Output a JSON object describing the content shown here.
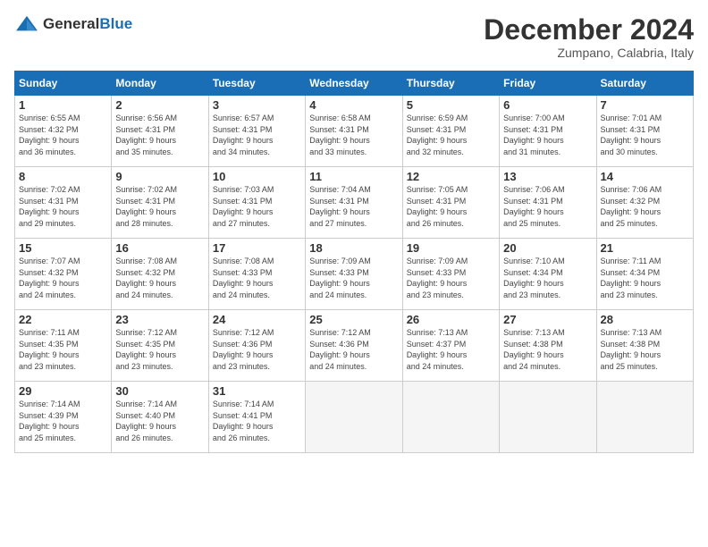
{
  "header": {
    "logo_general": "General",
    "logo_blue": "Blue",
    "month": "December 2024",
    "location": "Zumpano, Calabria, Italy"
  },
  "weekdays": [
    "Sunday",
    "Monday",
    "Tuesday",
    "Wednesday",
    "Thursday",
    "Friday",
    "Saturday"
  ],
  "weeks": [
    [
      {
        "day": "1",
        "info": "Sunrise: 6:55 AM\nSunset: 4:32 PM\nDaylight: 9 hours\nand 36 minutes."
      },
      {
        "day": "2",
        "info": "Sunrise: 6:56 AM\nSunset: 4:31 PM\nDaylight: 9 hours\nand 35 minutes."
      },
      {
        "day": "3",
        "info": "Sunrise: 6:57 AM\nSunset: 4:31 PM\nDaylight: 9 hours\nand 34 minutes."
      },
      {
        "day": "4",
        "info": "Sunrise: 6:58 AM\nSunset: 4:31 PM\nDaylight: 9 hours\nand 33 minutes."
      },
      {
        "day": "5",
        "info": "Sunrise: 6:59 AM\nSunset: 4:31 PM\nDaylight: 9 hours\nand 32 minutes."
      },
      {
        "day": "6",
        "info": "Sunrise: 7:00 AM\nSunset: 4:31 PM\nDaylight: 9 hours\nand 31 minutes."
      },
      {
        "day": "7",
        "info": "Sunrise: 7:01 AM\nSunset: 4:31 PM\nDaylight: 9 hours\nand 30 minutes."
      }
    ],
    [
      {
        "day": "8",
        "info": "Sunrise: 7:02 AM\nSunset: 4:31 PM\nDaylight: 9 hours\nand 29 minutes."
      },
      {
        "day": "9",
        "info": "Sunrise: 7:02 AM\nSunset: 4:31 PM\nDaylight: 9 hours\nand 28 minutes."
      },
      {
        "day": "10",
        "info": "Sunrise: 7:03 AM\nSunset: 4:31 PM\nDaylight: 9 hours\nand 27 minutes."
      },
      {
        "day": "11",
        "info": "Sunrise: 7:04 AM\nSunset: 4:31 PM\nDaylight: 9 hours\nand 27 minutes."
      },
      {
        "day": "12",
        "info": "Sunrise: 7:05 AM\nSunset: 4:31 PM\nDaylight: 9 hours\nand 26 minutes."
      },
      {
        "day": "13",
        "info": "Sunrise: 7:06 AM\nSunset: 4:31 PM\nDaylight: 9 hours\nand 25 minutes."
      },
      {
        "day": "14",
        "info": "Sunrise: 7:06 AM\nSunset: 4:32 PM\nDaylight: 9 hours\nand 25 minutes."
      }
    ],
    [
      {
        "day": "15",
        "info": "Sunrise: 7:07 AM\nSunset: 4:32 PM\nDaylight: 9 hours\nand 24 minutes."
      },
      {
        "day": "16",
        "info": "Sunrise: 7:08 AM\nSunset: 4:32 PM\nDaylight: 9 hours\nand 24 minutes."
      },
      {
        "day": "17",
        "info": "Sunrise: 7:08 AM\nSunset: 4:33 PM\nDaylight: 9 hours\nand 24 minutes."
      },
      {
        "day": "18",
        "info": "Sunrise: 7:09 AM\nSunset: 4:33 PM\nDaylight: 9 hours\nand 24 minutes."
      },
      {
        "day": "19",
        "info": "Sunrise: 7:09 AM\nSunset: 4:33 PM\nDaylight: 9 hours\nand 23 minutes."
      },
      {
        "day": "20",
        "info": "Sunrise: 7:10 AM\nSunset: 4:34 PM\nDaylight: 9 hours\nand 23 minutes."
      },
      {
        "day": "21",
        "info": "Sunrise: 7:11 AM\nSunset: 4:34 PM\nDaylight: 9 hours\nand 23 minutes."
      }
    ],
    [
      {
        "day": "22",
        "info": "Sunrise: 7:11 AM\nSunset: 4:35 PM\nDaylight: 9 hours\nand 23 minutes."
      },
      {
        "day": "23",
        "info": "Sunrise: 7:12 AM\nSunset: 4:35 PM\nDaylight: 9 hours\nand 23 minutes."
      },
      {
        "day": "24",
        "info": "Sunrise: 7:12 AM\nSunset: 4:36 PM\nDaylight: 9 hours\nand 23 minutes."
      },
      {
        "day": "25",
        "info": "Sunrise: 7:12 AM\nSunset: 4:36 PM\nDaylight: 9 hours\nand 24 minutes."
      },
      {
        "day": "26",
        "info": "Sunrise: 7:13 AM\nSunset: 4:37 PM\nDaylight: 9 hours\nand 24 minutes."
      },
      {
        "day": "27",
        "info": "Sunrise: 7:13 AM\nSunset: 4:38 PM\nDaylight: 9 hours\nand 24 minutes."
      },
      {
        "day": "28",
        "info": "Sunrise: 7:13 AM\nSunset: 4:38 PM\nDaylight: 9 hours\nand 25 minutes."
      }
    ],
    [
      {
        "day": "29",
        "info": "Sunrise: 7:14 AM\nSunset: 4:39 PM\nDaylight: 9 hours\nand 25 minutes."
      },
      {
        "day": "30",
        "info": "Sunrise: 7:14 AM\nSunset: 4:40 PM\nDaylight: 9 hours\nand 26 minutes."
      },
      {
        "day": "31",
        "info": "Sunrise: 7:14 AM\nSunset: 4:41 PM\nDaylight: 9 hours\nand 26 minutes."
      },
      {
        "day": "",
        "info": ""
      },
      {
        "day": "",
        "info": ""
      },
      {
        "day": "",
        "info": ""
      },
      {
        "day": "",
        "info": ""
      }
    ]
  ]
}
